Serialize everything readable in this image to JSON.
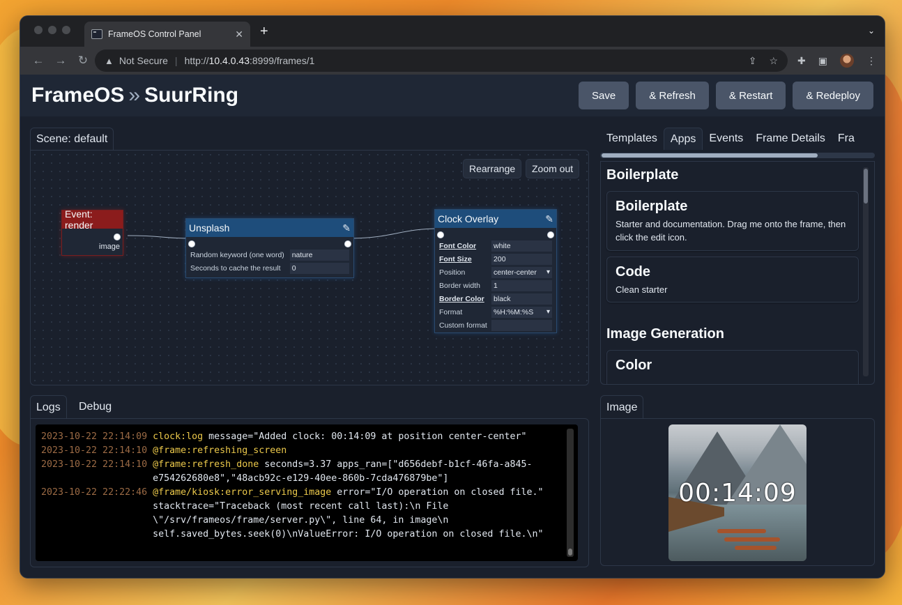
{
  "browser": {
    "tab_title": "FrameOS Control Panel",
    "tab_close": "✕",
    "new_tab": "+",
    "security_label": "Not Secure",
    "url_scheme": "http://",
    "url_host": "10.4.0.43",
    "url_path": ":8999/frames/1"
  },
  "header": {
    "title_app": "FrameOS",
    "title_sep": "»",
    "title_frame": "SuurRing",
    "buttons": [
      "Save",
      "& Refresh",
      "& Restart",
      "& Redeploy"
    ]
  },
  "scene": {
    "tab_label": "Scene: default",
    "rearrange": "Rearrange",
    "zoom_out": "Zoom out",
    "nodes": {
      "event": {
        "title": "Event: render",
        "output": "image"
      },
      "unsplash": {
        "title": "Unsplash",
        "fields": [
          {
            "label": "Random keyword (one word)",
            "value": "nature"
          },
          {
            "label": "Seconds to cache the result",
            "value": "0"
          }
        ]
      },
      "clock": {
        "title": "Clock Overlay",
        "fields": [
          {
            "label": "Font Color",
            "value": "white",
            "bold": true
          },
          {
            "label": "Font Size",
            "value": "200",
            "bold": true
          },
          {
            "label": "Position",
            "value": "center-center",
            "select": true
          },
          {
            "label": "Border width",
            "value": "1"
          },
          {
            "label": "Border Color",
            "value": "black",
            "bold": true
          },
          {
            "label": "Format",
            "value": "%H:%M:%S",
            "select": true
          },
          {
            "label": "Custom format",
            "value": ""
          }
        ]
      }
    }
  },
  "side_tabs": [
    "Templates",
    "Apps",
    "Events",
    "Frame Details",
    "Fra"
  ],
  "apps": {
    "cat1": "Boilerplate",
    "cards1": [
      {
        "name": "Boilerplate",
        "desc": "Starter and documentation. Drag me onto the frame, then click the edit icon."
      },
      {
        "name": "Code",
        "desc": "Clean starter"
      }
    ],
    "cat2": "Image Generation",
    "cards2": [
      {
        "name": "Color",
        "desc": ""
      }
    ]
  },
  "logs": {
    "tab_logs": "Logs",
    "tab_debug": "Debug",
    "lines": [
      {
        "time": "2023-10-22 22:14:09",
        "event": "clock:log",
        "rest": " message=\"Added clock: 00:14:09 at position center-center\""
      },
      {
        "time": "2023-10-22 22:14:10",
        "event": "@frame:refreshing_screen",
        "rest": ""
      },
      {
        "time": "2023-10-22 22:14:10",
        "event": "@frame:refresh_done",
        "rest": " seconds=3.37 apps_ran=[\"d656debf-b1cf-46fa-a845-e754262680e8\",\"48acb92c-e129-40ee-860b-7cda476879be\"]"
      },
      {
        "time": "2023-10-22 22:22:46",
        "event": "@frame/kiosk:error_serving_image",
        "rest": " error=\"I/O operation on closed file.\" stacktrace=\"Traceback (most recent call last):\\n File \\\"/srv/frameos/frame/server.py\\\", line 64, in image\\n self.saved_bytes.seek(0)\\nValueError: I/O operation on closed file.\\n\""
      }
    ]
  },
  "image_panel": {
    "tab_label": "Image",
    "clock_text": "00:14:09"
  }
}
